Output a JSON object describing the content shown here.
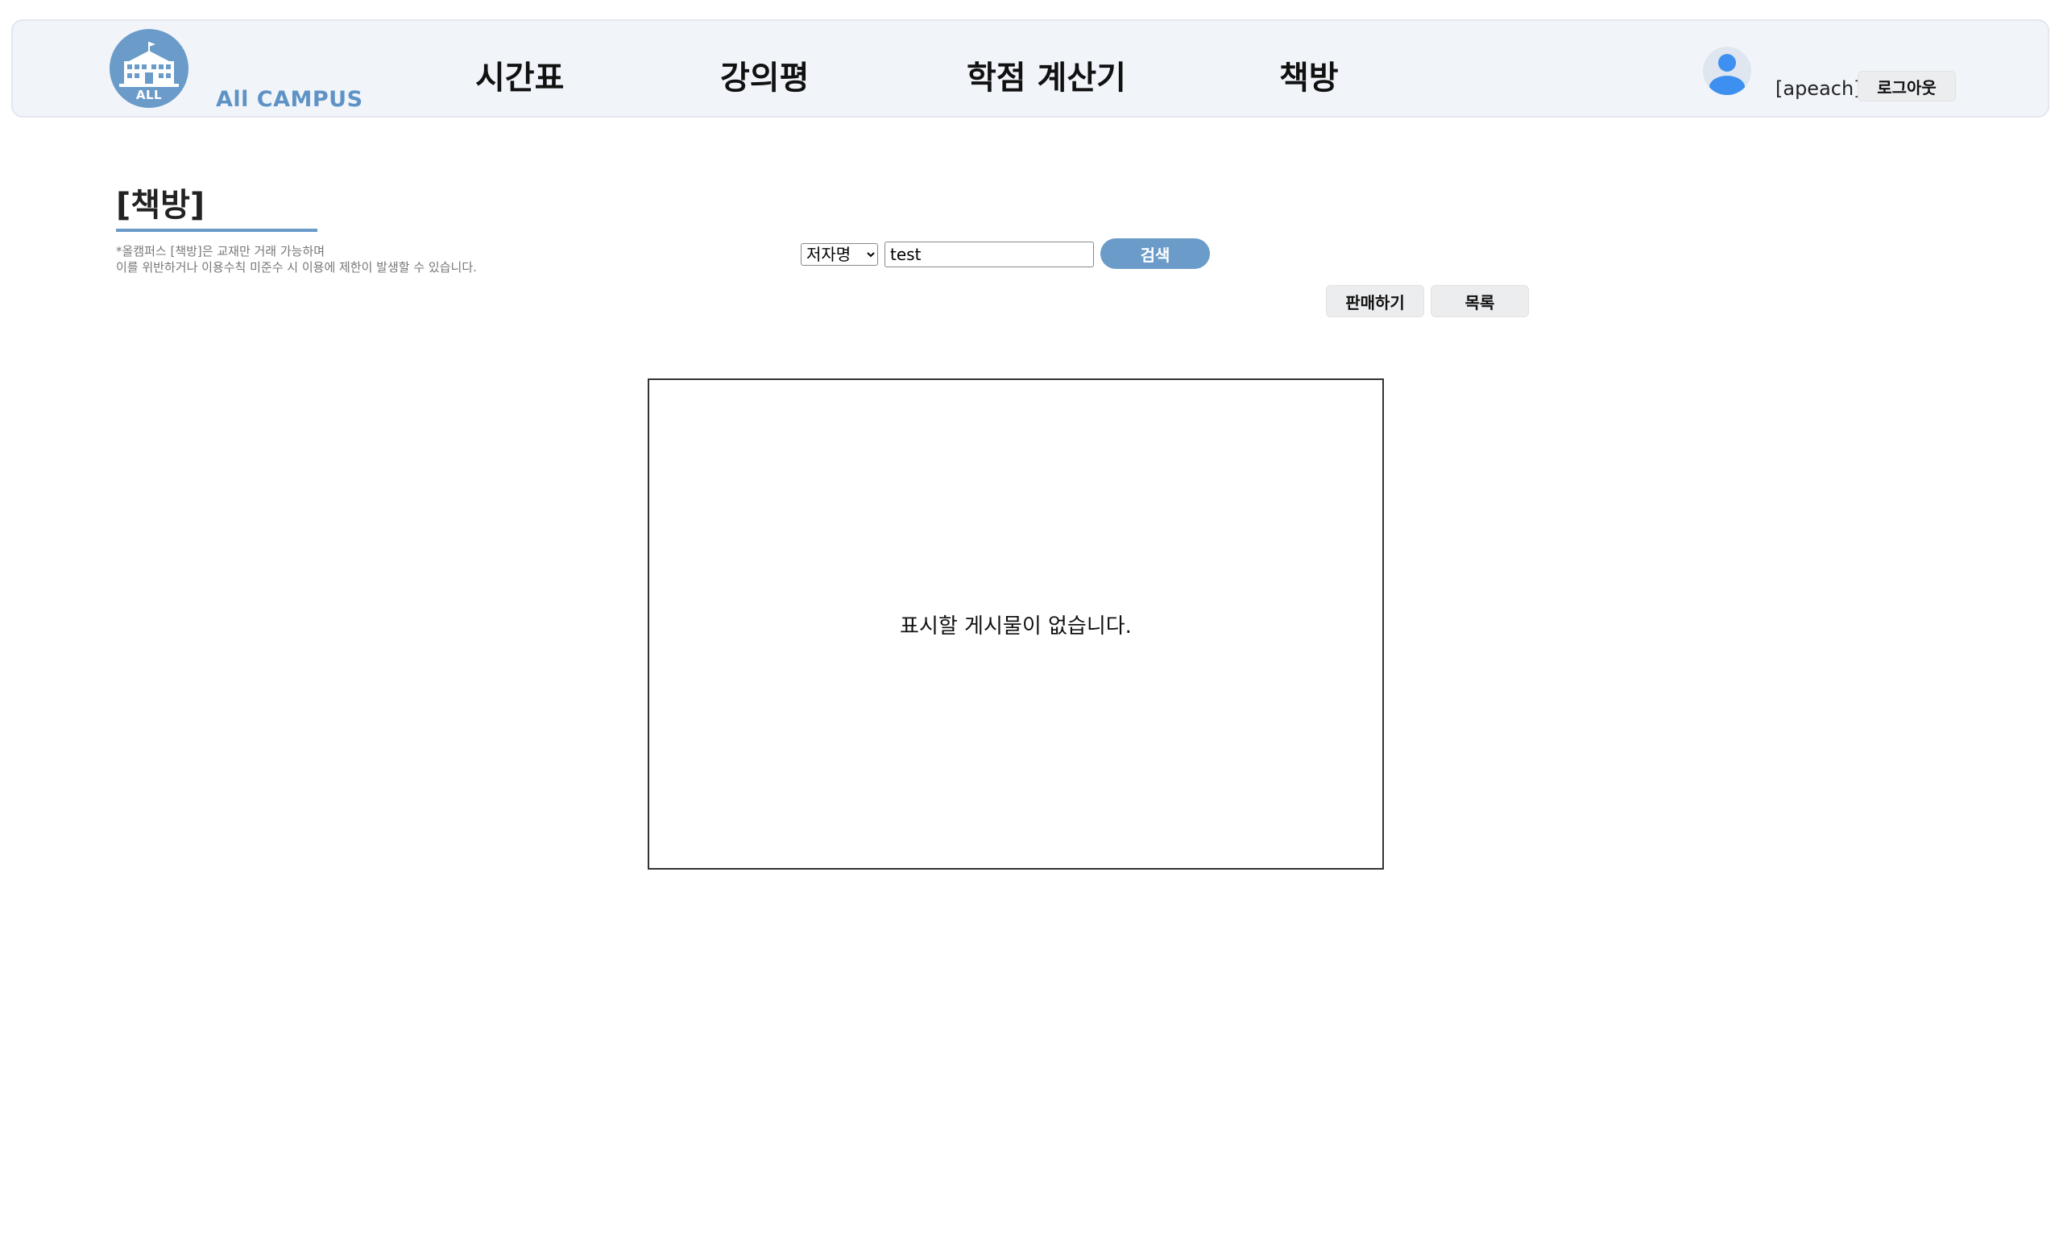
{
  "header": {
    "brand": "All CAMPUS",
    "logo_text": "ALL",
    "nav": [
      "시간표",
      "강의평",
      "학점 계산기",
      "책방"
    ],
    "username": "[apeach]",
    "logout_label": "로그아웃"
  },
  "board": {
    "title": "[책방]",
    "notice_line1": "*올캠퍼스 [책방]은 교재만 거래 가능하며",
    "notice_line2": "이를 위반하거나 이용수칙 미준수 시 이용에 제한이 발생할 수 있습니다."
  },
  "search": {
    "selected_option": "저자명",
    "query": "test",
    "button_label": "검색"
  },
  "actions": {
    "sell_label": "판매하기",
    "list_label": "목록"
  },
  "posts": {
    "empty_message": "표시할 게시물이 없습니다."
  },
  "colors": {
    "accent": "#6a9bc9",
    "header_bg": "#f1f5fa",
    "button_bg": "#ecedef",
    "avatar_icon": "#3d8ff0"
  }
}
